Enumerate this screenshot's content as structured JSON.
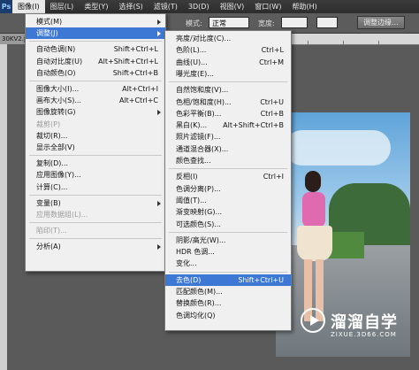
{
  "menubar": {
    "items": [
      "图像(I)",
      "图层(L)",
      "类型(Y)",
      "选择(S)",
      "滤镜(T)",
      "3D(D)",
      "视图(V)",
      "窗口(W)",
      "帮助(H)"
    ]
  },
  "options_bar": {
    "mode_label": "模式:",
    "mode_value": "正常",
    "width_label": "宽度:",
    "button": "调整边缘..."
  },
  "doc_tab": "30KV2.jp",
  "image_menu": {
    "items": [
      {
        "label": "模式(M)",
        "shortcut": "",
        "submenu": true
      },
      {
        "label": "调整(J)",
        "shortcut": "",
        "submenu": true,
        "highlighted": true
      },
      {
        "label": "自动色调(N)",
        "shortcut": "Shift+Ctrl+L"
      },
      {
        "label": "自动对比度(U)",
        "shortcut": "Alt+Shift+Ctrl+L"
      },
      {
        "label": "自动颜色(O)",
        "shortcut": "Shift+Ctrl+B"
      },
      {
        "label": "图像大小(I)...",
        "shortcut": "Alt+Ctrl+I"
      },
      {
        "label": "画布大小(S)...",
        "shortcut": "Alt+Ctrl+C"
      },
      {
        "label": "图像旋转(G)",
        "shortcut": "",
        "submenu": true
      },
      {
        "label": "裁剪(P)",
        "shortcut": "",
        "disabled": true
      },
      {
        "label": "裁切(R)...",
        "shortcut": ""
      },
      {
        "label": "显示全部(V)",
        "shortcut": ""
      },
      {
        "label": "复制(D)...",
        "shortcut": ""
      },
      {
        "label": "应用图像(Y)...",
        "shortcut": ""
      },
      {
        "label": "计算(C)...",
        "shortcut": ""
      },
      {
        "label": "变量(B)",
        "shortcut": "",
        "submenu": true
      },
      {
        "label": "应用数据组(L)...",
        "shortcut": "",
        "disabled": true
      },
      {
        "label": "陷印(T)...",
        "shortcut": "",
        "disabled": true
      },
      {
        "label": "分析(A)",
        "shortcut": "",
        "submenu": true
      }
    ]
  },
  "adjust_menu": {
    "items": [
      {
        "label": "亮度/对比度(C)...",
        "shortcut": ""
      },
      {
        "label": "色阶(L)...",
        "shortcut": "Ctrl+L"
      },
      {
        "label": "曲线(U)...",
        "shortcut": "Ctrl+M"
      },
      {
        "label": "曝光度(E)...",
        "shortcut": ""
      },
      {
        "label": "自然饱和度(V)...",
        "shortcut": ""
      },
      {
        "label": "色相/饱和度(H)...",
        "shortcut": "Ctrl+U"
      },
      {
        "label": "色彩平衡(B)...",
        "shortcut": "Ctrl+B"
      },
      {
        "label": "黑白(K)...",
        "shortcut": "Alt+Shift+Ctrl+B"
      },
      {
        "label": "照片滤镜(F)...",
        "shortcut": ""
      },
      {
        "label": "通道混合器(X)...",
        "shortcut": ""
      },
      {
        "label": "颜色查找...",
        "shortcut": ""
      },
      {
        "label": "反相(I)",
        "shortcut": "Ctrl+I"
      },
      {
        "label": "色调分离(P)...",
        "shortcut": ""
      },
      {
        "label": "阈值(T)...",
        "shortcut": ""
      },
      {
        "label": "渐变映射(G)...",
        "shortcut": ""
      },
      {
        "label": "可选颜色(S)...",
        "shortcut": ""
      },
      {
        "label": "阴影/高光(W)...",
        "shortcut": ""
      },
      {
        "label": "HDR 色调...",
        "shortcut": ""
      },
      {
        "label": "变化...",
        "shortcut": ""
      },
      {
        "label": "去色(D)",
        "shortcut": "Shift+Ctrl+U",
        "highlighted": true
      },
      {
        "label": "匹配颜色(M)...",
        "shortcut": ""
      },
      {
        "label": "替换颜色(R)...",
        "shortcut": ""
      },
      {
        "label": "色调均化(Q)",
        "shortcut": ""
      }
    ]
  },
  "watermark": {
    "name": "溜溜自学",
    "url": "ZIXUE.3D66.COM"
  },
  "colors": {
    "highlight": "#3d78d4",
    "menu_bg": "#f0f0f0",
    "app_bg": "#5a5a5a"
  }
}
